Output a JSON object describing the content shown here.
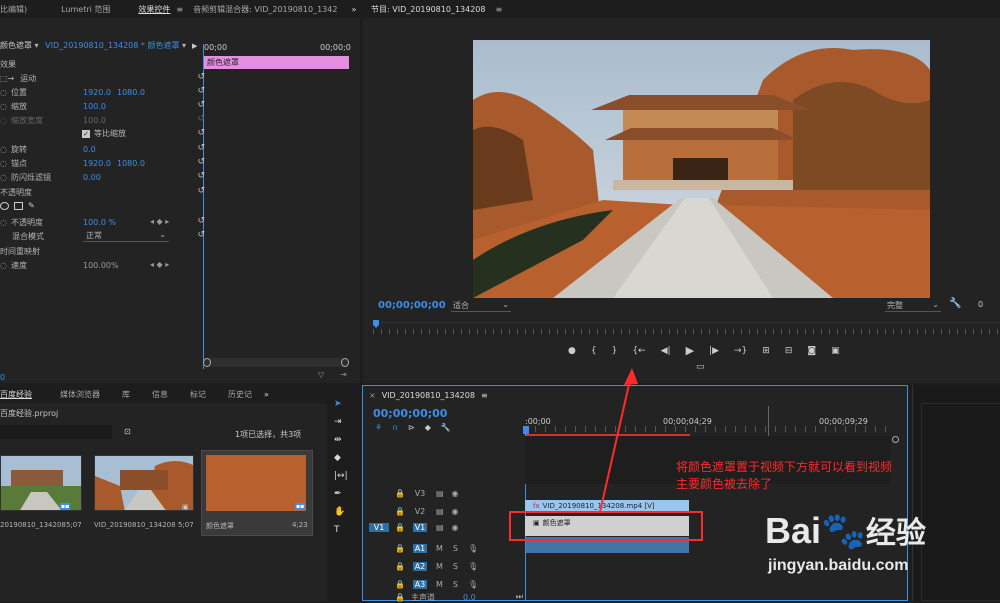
{
  "top_tabs": {
    "source": "比编辑)",
    "lumetri": "Lumetri 范围",
    "effect_controls": "效果控件",
    "audio_mixer": "音频剪辑混合器: VID_20190810_1342",
    "more": "»"
  },
  "program": {
    "title": "节目: VID_20190810_134208",
    "menu": "≡",
    "timecode": "00;00;00;00",
    "fit": "适合",
    "quality": "完整",
    "controls": [
      "●",
      "{",
      "}",
      "{←",
      "◀|",
      "▶",
      "|▶",
      "→}",
      "⊞",
      "⊞",
      "📷",
      "⊞"
    ]
  },
  "effect_controls": {
    "source_label": "颜色遮罩",
    "clip_label": "VID_20190810_134208 * 颜色遮罩",
    "mini_start": "00;00",
    "mini_end": "00;00;0",
    "clip_bar": "颜色遮罩",
    "video_label": "效果",
    "motion": "运动",
    "position_label": "位置",
    "position_x": "1920.0",
    "position_y": "1080.0",
    "scale_label": "缩放",
    "scale_val": "100.0",
    "scale_width_label": "缩放宽度",
    "scale_width_val": "100.0",
    "uniform_scale": "等比缩放",
    "rotation_label": "旋转",
    "rotation_val": "0.0",
    "anchor_label": "锚点",
    "anchor_x": "1920.0",
    "anchor_y": "1080.0",
    "flicker_label": "防闪烁滤镜",
    "flicker_val": "0.00",
    "opacity_section": "不透明度",
    "opacity_label": "不透明度",
    "opacity_val": "100.0 %",
    "blend_label": "混合模式",
    "blend_val": "正常",
    "time_remap": "时间重映射",
    "speed_label": "速度",
    "speed_val": "100.00%",
    "bottom_tc": "0"
  },
  "project": {
    "tabs": [
      "百度经验",
      "媒体浏览器",
      "库",
      "信息",
      "标记",
      "历史记"
    ],
    "file": "百度经验.prproj",
    "selection_info": "1项已选择，共3项",
    "items": [
      {
        "name": "20190810_134208",
        "dur": "5;07"
      },
      {
        "name": "VID_20190810_134208",
        "dur": "5;07"
      },
      {
        "name": "颜色遮罩",
        "dur": "4;23"
      }
    ]
  },
  "timeline": {
    "title": "VID_20190810_134208",
    "menu": "≡",
    "timecode": "00;00;00;00",
    "ruler": [
      ":00;00",
      "00;00;04;29",
      "00;00;09;29"
    ],
    "tracks_video": [
      "V3",
      "V2",
      "V1"
    ],
    "tracks_audio": [
      "A1",
      "A2",
      "A3"
    ],
    "v1_source": "V1",
    "clip_v2": "VID_20190810_134208.mp4 [V]",
    "clip_v1": "颜色遮罩",
    "master": "主声道",
    "master_val": "0.0",
    "ms": [
      "M",
      "S"
    ]
  },
  "annotation": {
    "line1": "将颜色遮罩置于视频下方就可以看到视频",
    "line2": "主要颜色被去除了",
    "color": "#ff2a2a"
  },
  "watermark": {
    "brand": "Bai",
    "brand2": "经验",
    "url": "jingyan.baidu.com"
  }
}
